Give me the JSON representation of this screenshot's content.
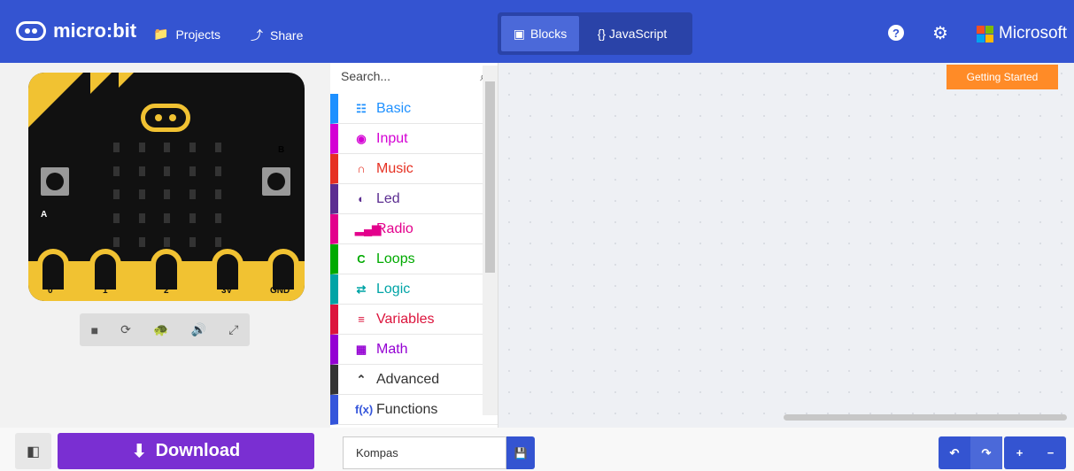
{
  "header": {
    "logo_text": "micro:bit",
    "projects_label": "Projects",
    "share_label": "Share",
    "blocks_label": "Blocks",
    "javascript_label": "{} JavaScript",
    "help_icon": "?",
    "settings_icon": "gear",
    "brand_label": "Microsoft",
    "colors": {
      "header": "#3454d1",
      "accent": "#ff8b27",
      "download": "#7a2fd2"
    }
  },
  "simulator": {
    "button_a": "A",
    "button_b": "B",
    "pins": [
      "0",
      "1",
      "2",
      "3V",
      "GND"
    ],
    "controls": [
      "■",
      "⟳",
      "🐢",
      "🔊",
      "⤢"
    ]
  },
  "toolbox": {
    "search_placeholder": "Search...",
    "categories": [
      {
        "label": "Basic",
        "glyph": "☷",
        "color": "#1e90ff"
      },
      {
        "label": "Input",
        "glyph": "◉",
        "color": "#d400d4"
      },
      {
        "label": "Music",
        "glyph": "∩",
        "color": "#e63022"
      },
      {
        "label": "Led",
        "glyph": "◐",
        "color": "#5c2d91"
      },
      {
        "label": "Radio",
        "glyph": "▂▄▆",
        "color": "#e3008c"
      },
      {
        "label": "Loops",
        "glyph": "C",
        "color": "#00aa00"
      },
      {
        "label": "Logic",
        "glyph": "⇄",
        "color": "#00a4a6"
      },
      {
        "label": "Variables",
        "glyph": "≡",
        "color": "#dc143c"
      },
      {
        "label": "Math",
        "glyph": "▦",
        "color": "#9400d3"
      },
      {
        "label": "Advanced",
        "glyph": "⌃",
        "color": "#333333"
      },
      {
        "label": "Functions",
        "glyph": "f(x)",
        "color": "#3455db"
      }
    ]
  },
  "workspace": {
    "getting_started_label": "Getting Started"
  },
  "footer": {
    "download_label": "Download",
    "project_name": "Kompas",
    "save_icon": "save",
    "undo_icon": "↶",
    "redo_icon": "↷",
    "zoom_in_icon": "+",
    "zoom_out_icon": "−"
  }
}
